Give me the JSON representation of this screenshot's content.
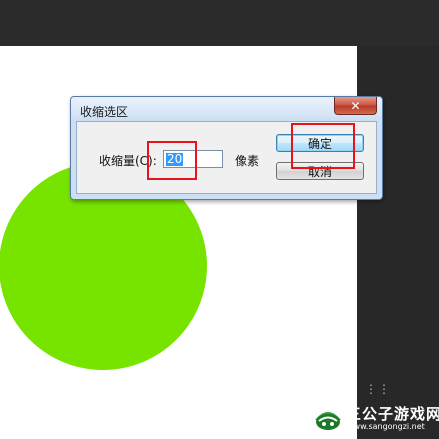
{
  "dialog": {
    "title": "收缩选区",
    "close_symbol": "✕",
    "shrink_label": "收缩量(C):",
    "shrink_value": "20",
    "unit": "像素",
    "ok_label": "确定",
    "cancel_label": "取消"
  },
  "canvas": {
    "shape_color": "#77e400",
    "background": "#ffffff"
  },
  "annotations": {
    "highlight_color": "#e8141d"
  },
  "watermark": {
    "title": "三公子游戏网",
    "url": "www.sangongzi.net",
    "icon": "game-logo-icon"
  }
}
